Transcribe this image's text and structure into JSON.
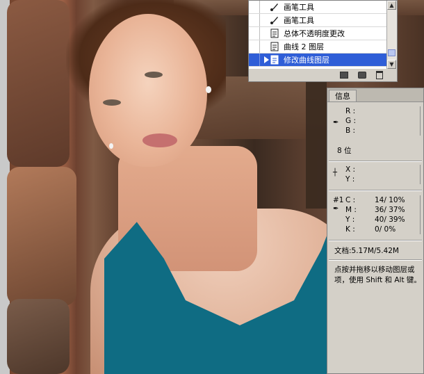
{
  "history_panel": {
    "items": [
      {
        "label": "画笔工具",
        "icon": "brush-icon",
        "active": false
      },
      {
        "label": "画笔工具",
        "icon": "brush-icon",
        "active": false
      },
      {
        "label": "总体不透明度更改",
        "icon": "document-icon",
        "active": false
      },
      {
        "label": "曲线 2 图层",
        "icon": "document-icon",
        "active": false
      },
      {
        "label": "修改曲线图层",
        "icon": "document-icon",
        "active": true
      }
    ],
    "footer_icons": [
      "new-document-from-state-icon",
      "new-snapshot-icon",
      "trash-icon"
    ]
  },
  "info_panel": {
    "tab_label": "信息",
    "rgb": {
      "r_label": "R :",
      "g_label": "G :",
      "b_label": "B :"
    },
    "bit_depth": "8 位",
    "xy": {
      "x_label": "X :",
      "y_label": "Y :"
    },
    "sample_id": "#1",
    "cmyk": {
      "c_label": "C :",
      "c_value": "14/  10%",
      "m_label": "M :",
      "m_value": "36/  37%",
      "y_label": "Y :",
      "y_value": "40/  39%",
      "k_label": "K :",
      "k_value": "0/   0%"
    },
    "doc_size": "文档:5.17M/5.42M",
    "hint_line1": "点按并拖移以移动图层或",
    "hint_line2": "项，使用 Shift 和 Alt 键。"
  },
  "colors": {
    "selection": "#2f5ed7",
    "panel_bg": "#d4d0c8",
    "tank_top": "#0f6c83"
  }
}
